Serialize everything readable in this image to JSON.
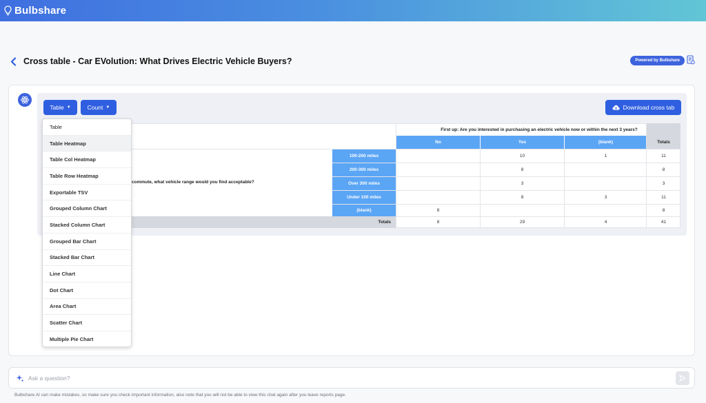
{
  "app": {
    "name": "Bulbshare"
  },
  "header": {
    "title": "Cross table - Car EVolution: What Drives Electric Vehicle Buyers?",
    "powered_badge": "Powered by Bulbshare"
  },
  "toolbar": {
    "table_label": "Table",
    "count_label": "Count",
    "download_label": "Download cross tab"
  },
  "crosstab": {
    "column_question": "First up: Are you interested in purchasing an electric vehicle now or within the next 3 years?",
    "row_question_visible": "commute, what vehicle range would you find acceptable?",
    "columns": [
      "No",
      "Yes",
      "(blank)"
    ],
    "totals_header": "Totals",
    "rows": [
      {
        "label": "100-200 miles",
        "no": "",
        "yes": "10",
        "blank": "1",
        "total": "11"
      },
      {
        "label": "200-300 miles",
        "no": "",
        "yes": "8",
        "blank": "",
        "total": "8"
      },
      {
        "label": "Over 300 miles",
        "no": "",
        "yes": "3",
        "blank": "",
        "total": "3"
      },
      {
        "label": "Under 100 miles",
        "no": "",
        "yes": "8",
        "blank": "3",
        "total": "11"
      },
      {
        "label": "(blank)",
        "no": "8",
        "yes": "",
        "blank": "",
        "total": "8"
      }
    ],
    "totals_row": {
      "label": "Totals",
      "no": "8",
      "yes": "29",
      "blank": "4",
      "total": "41"
    }
  },
  "dropdown": {
    "items": [
      "Table",
      "Table Heatmap",
      "Table Col Heatmap",
      "Table Row Heatmap",
      "Exportable TSV",
      "Grouped Column Chart",
      "Stacked Column Chart",
      "Grouped Bar Chart",
      "Stacked Bar Chart",
      "Line Chart",
      "Dot Chart",
      "Area Chart",
      "Scatter Chart",
      "Multiple Pie Chart"
    ],
    "hovered": "Table Heatmap"
  },
  "ask": {
    "placeholder": "Ask a question?",
    "disclaimer": "Bulbshare AI can make mistakes, so make sure you check important information, also note that you will not be able to view this chat again after you leave reports page."
  },
  "colors": {
    "brand": "#3d63dd",
    "button": "#2f5fe0",
    "header_cell": "#5ba5f5",
    "totals_cell": "#d5d8de"
  },
  "icons": {
    "logo": "bulb-icon",
    "back": "chevron-left-icon",
    "report": "document-chart-icon",
    "assistant": "atom-icon",
    "download": "cloud-download-icon",
    "sparkle": "sparkle-icon",
    "send": "send-icon"
  }
}
